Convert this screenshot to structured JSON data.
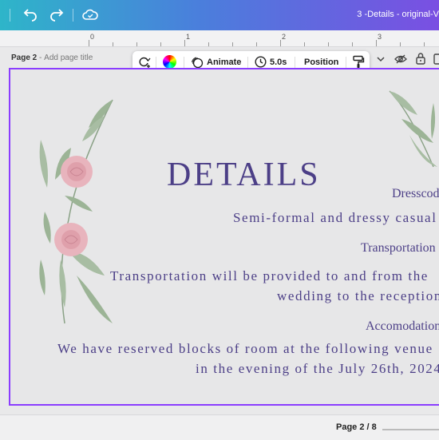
{
  "header": {
    "doc_title": "3 -Details - original-V"
  },
  "ruler": {
    "marks": [
      "0",
      "1",
      "2",
      "3"
    ]
  },
  "page": {
    "label": "Page 2",
    "separator": "-",
    "add_title": "Add page title"
  },
  "toolbar": {
    "animate_label": "Animate",
    "duration_label": "5.0s",
    "position_label": "Position"
  },
  "card": {
    "heading": "DETAILS",
    "dresscode_title": "Dresscode",
    "dresscode_text": "Semi-formal and dressy casual",
    "transport_title": "Transportation",
    "transport_line1": "Transportation will be provided to and from  the",
    "transport_line2": "wedding to the reception",
    "accom_title": "Accomodations",
    "accom_line1": "We have reserved blocks of room at the following venue",
    "accom_line2": "in the evening of the July 26th, 2024"
  },
  "footer": {
    "page_indicator": "Page 2 / 8"
  },
  "colors": {
    "accent": "#8b3dff",
    "text": "#4c3f87",
    "rose": "#e8b4bd",
    "leaf": "#8fa58a"
  }
}
